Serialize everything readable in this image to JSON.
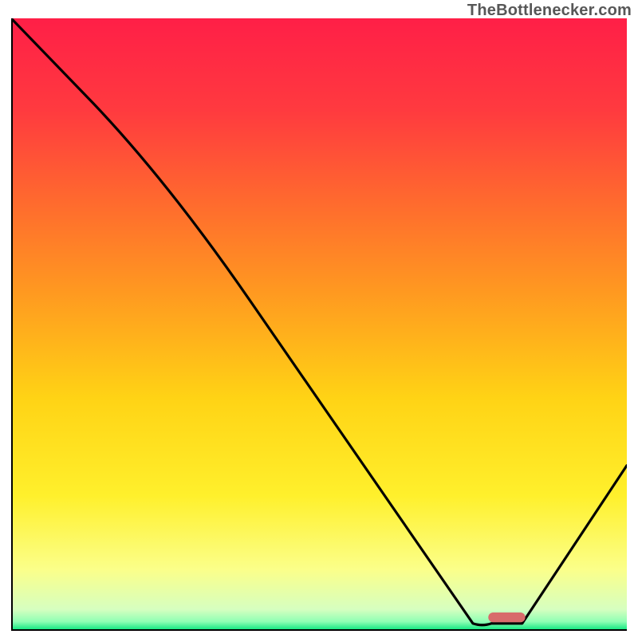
{
  "attribution": "TheBottlenecker.com",
  "chart_data": {
    "type": "line",
    "title": "",
    "xlabel": "",
    "ylabel": "",
    "xlim": [
      0,
      100
    ],
    "ylim": [
      0,
      100
    ],
    "x": [
      0,
      25,
      75,
      78,
      83,
      100
    ],
    "values": [
      100,
      74,
      1.2,
      1.2,
      1.2,
      27
    ],
    "marker": {
      "x_center": 80.5,
      "y": 2.2,
      "width": 6,
      "height": 1.6,
      "color": "#d86b6b"
    },
    "gradient_stops": [
      {
        "t": 0.0,
        "c": "#ff1f47"
      },
      {
        "t": 0.15,
        "c": "#ff3a3f"
      },
      {
        "t": 0.3,
        "c": "#ff6a2e"
      },
      {
        "t": 0.45,
        "c": "#ff9a20"
      },
      {
        "t": 0.62,
        "c": "#ffd315"
      },
      {
        "t": 0.78,
        "c": "#fff02c"
      },
      {
        "t": 0.9,
        "c": "#fbff8a"
      },
      {
        "t": 0.965,
        "c": "#d6ffc0"
      },
      {
        "t": 0.985,
        "c": "#8fffb4"
      },
      {
        "t": 1.0,
        "c": "#00e37a"
      }
    ],
    "axis_color": "#000000",
    "line_color": "#000000"
  }
}
